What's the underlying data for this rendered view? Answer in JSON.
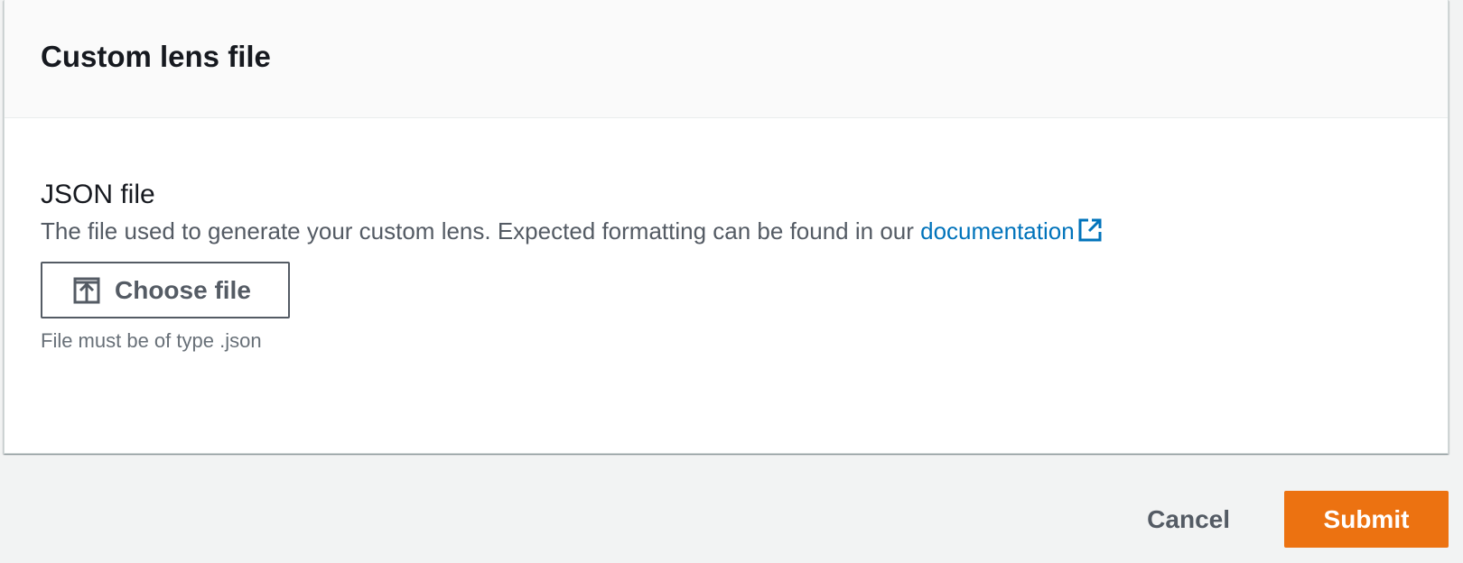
{
  "container": {
    "title": "Custom lens file"
  },
  "field": {
    "label": "JSON file",
    "description": "The file used to generate your custom lens. Expected formatting can be found in our ",
    "link_text": "documentation",
    "link_icon": "external-link-icon",
    "choose_file_label": "Choose file",
    "choose_file_icon": "upload-icon",
    "constraint": "File must be of type .json"
  },
  "actions": {
    "cancel_label": "Cancel",
    "submit_label": "Submit"
  },
  "colors": {
    "link": "#0073bb",
    "primary": "#ec7211",
    "text": "#16191f",
    "secondary_text": "#545b64",
    "background": "#f2f3f3"
  }
}
